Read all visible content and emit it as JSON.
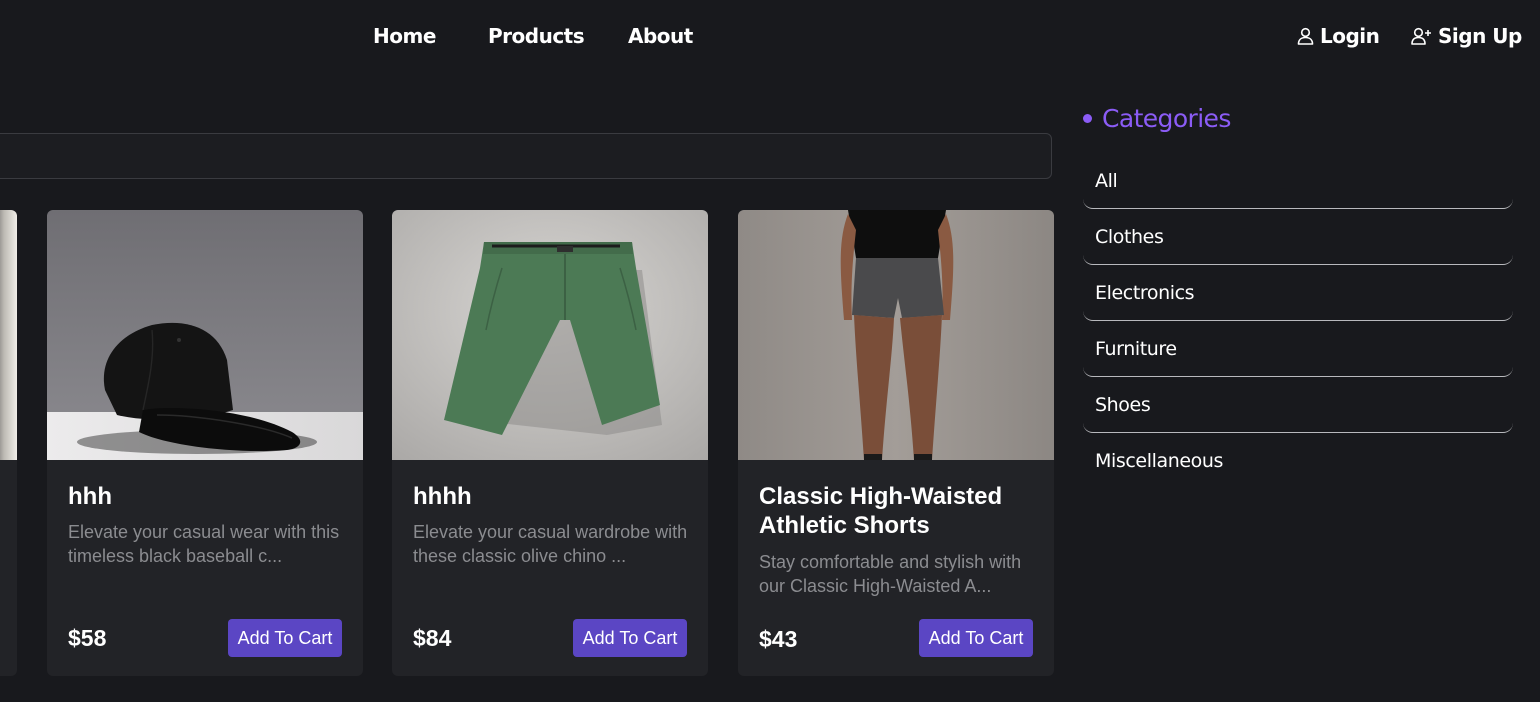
{
  "nav": {
    "links": [
      {
        "label": "Home"
      },
      {
        "label": "Products"
      },
      {
        "label": "About"
      }
    ],
    "login_label": "Login",
    "signup_label": "Sign Up",
    "login_icon": "user-icon",
    "signup_icon": "user-plus-icon"
  },
  "search": {
    "placeholder": "",
    "value": ""
  },
  "products": [
    {
      "title": "hhh",
      "description": "Elevate your casual wear with this timeless black baseball c...",
      "price": "$58",
      "button": "Add To Cart",
      "image": "black-baseball-cap-image"
    },
    {
      "title": "hhhh",
      "description": "Elevate your casual wardrobe with these classic olive chino ...",
      "price": "$84",
      "button": "Add To Cart",
      "image": "olive-chino-shorts-image"
    },
    {
      "title": "Classic High-Waisted Athletic Shorts",
      "description": "Stay comfortable and stylish with our Classic High-Waisted A...",
      "price": "$43",
      "button": "Add To Cart",
      "image": "athletic-shorts-model-image"
    }
  ],
  "categories": {
    "title": "Categories",
    "items": [
      "All",
      "Clothes",
      "Electronics",
      "Furniture",
      "Shoes",
      "Miscellaneous"
    ]
  },
  "colors": {
    "background": "#18191d",
    "card": "#222327",
    "accent": "#8b5cf6",
    "button": "#5b46c4",
    "muted_text": "#8b8c90"
  }
}
